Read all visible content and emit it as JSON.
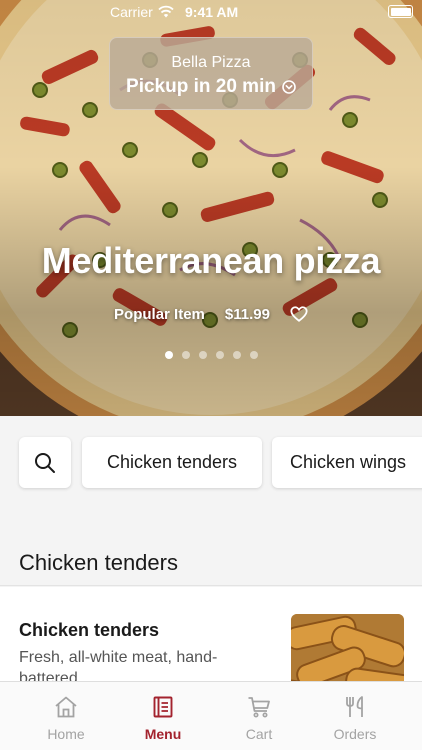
{
  "status_bar": {
    "carrier": "Carrier",
    "time": "9:41 AM"
  },
  "store": {
    "name": "Bella Pizza",
    "pickup": "Pickup in 20 min"
  },
  "hero": {
    "title": "Mediterranean pizza",
    "tag": "Popular Item",
    "price": "$11.99",
    "carousel": {
      "count": 6,
      "active_index": 0
    }
  },
  "categories": {
    "search_icon": "search-icon",
    "chips": [
      "Chicken tenders",
      "Chicken wings"
    ]
  },
  "section": {
    "title": "Chicken tenders"
  },
  "item": {
    "name": "Chicken tenders",
    "description": "Fresh, all-white meat, hand-battered."
  },
  "tabbar": {
    "active": "Menu",
    "tabs": [
      {
        "label": "Home",
        "icon": "home-icon"
      },
      {
        "label": "Menu",
        "icon": "menu-icon"
      },
      {
        "label": "Cart",
        "icon": "cart-icon"
      },
      {
        "label": "Orders",
        "icon": "fork-knife-icon"
      }
    ]
  },
  "colors": {
    "accent": "#a3232e",
    "inactive": "#a3a3a3",
    "background": "#f4f4f4"
  }
}
